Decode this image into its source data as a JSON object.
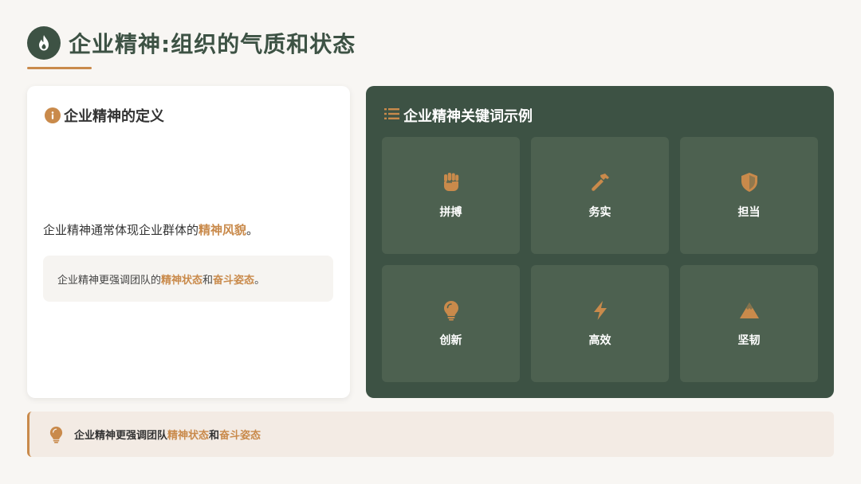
{
  "header": {
    "title": "企业精神:组织的气质和状态",
    "icon": "flame-icon"
  },
  "definition": {
    "heading": "企业精神的定义",
    "icon": "info-icon",
    "text_before": "企业精神通常体现企业群体的",
    "text_highlight": "精神风貌",
    "text_after": "。",
    "box_before": "企业精神更强调团队的",
    "box_hl1": "精神状态",
    "box_mid": "和",
    "box_hl2": "奋斗姿态",
    "box_after": "。"
  },
  "keywords": {
    "heading": "企业精神关键词示例",
    "icon": "list-icon",
    "items": [
      {
        "label": "拼搏",
        "icon": "fist-icon"
      },
      {
        "label": "务实",
        "icon": "hammer-icon"
      },
      {
        "label": "担当",
        "icon": "shield-icon"
      },
      {
        "label": "创新",
        "icon": "lightbulb-icon"
      },
      {
        "label": "高效",
        "icon": "lightning-icon"
      },
      {
        "label": "坚韧",
        "icon": "mountain-icon"
      }
    ]
  },
  "banner": {
    "icon": "lightbulb-icon",
    "text_before": "企业精神更强调团队",
    "hl1": "精神状态",
    "mid": "和",
    "hl2": "奋斗姿态"
  },
  "colors": {
    "primary_green": "#3d5244",
    "tile_green": "#4d6150",
    "accent_orange": "#c98a4b",
    "background": "#f8f6f3"
  }
}
